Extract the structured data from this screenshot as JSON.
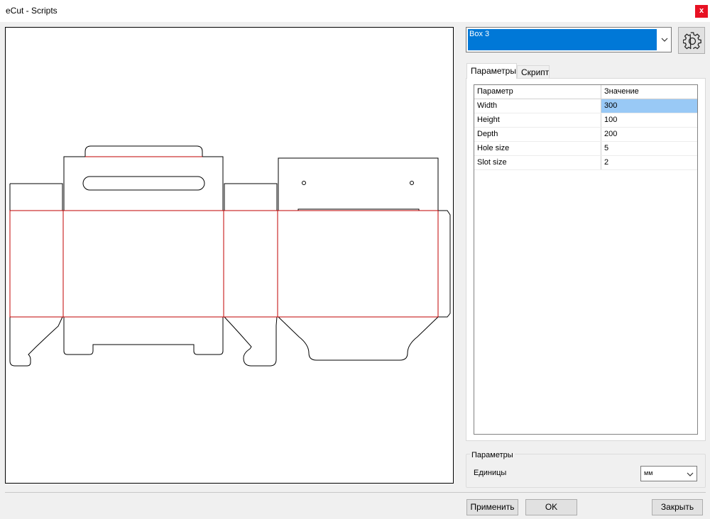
{
  "window": {
    "title": "eCut - Scripts",
    "close_label": "x"
  },
  "script_select": {
    "value": "Box 3"
  },
  "tabs": [
    {
      "label": "Параметры",
      "active": true
    },
    {
      "label": "Скрипт",
      "active": false
    }
  ],
  "grid": {
    "headers": [
      "Параметр",
      "Значение"
    ],
    "rows": [
      {
        "name": "Width",
        "value": "300"
      },
      {
        "name": "Height",
        "value": "100"
      },
      {
        "name": "Depth",
        "value": "200"
      },
      {
        "name": "Hole size",
        "value": "5"
      },
      {
        "name": "Slot size",
        "value": "2"
      }
    ]
  },
  "params_group": {
    "title": "Параметры",
    "units_label": "Единицы",
    "units_value": "мм"
  },
  "buttons": {
    "apply": "Применить",
    "ok": "OK",
    "close": "Закрыть"
  },
  "icons": {
    "settings": "gear-icon",
    "dropdown": "chevron-down-icon"
  },
  "colors": {
    "cut_line": "#000000",
    "fold_line": "#c00000",
    "selection": "#0078d7",
    "cell_selected": "#99c9f6"
  }
}
